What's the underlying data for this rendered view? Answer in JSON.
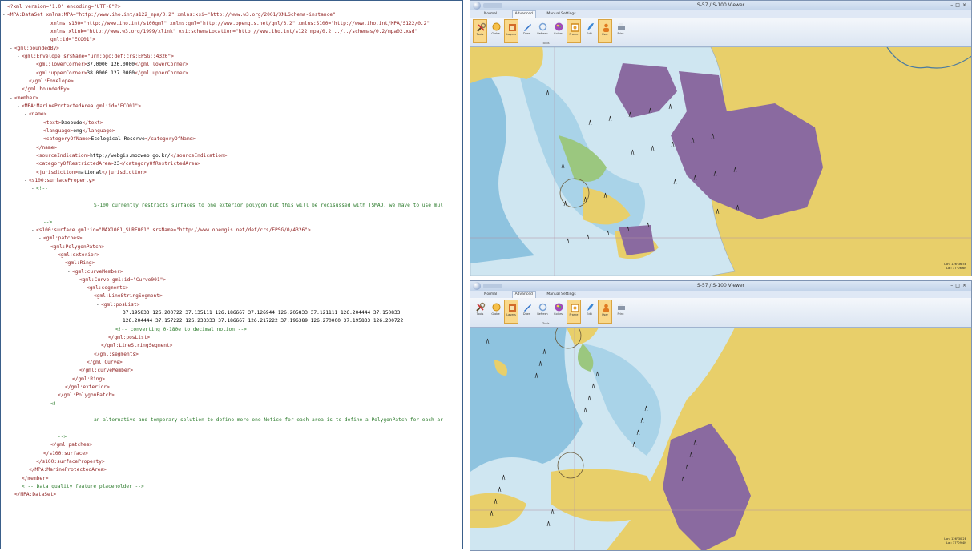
{
  "xml": {
    "lines": [
      {
        "indent": 0,
        "tw": "",
        "parts": [
          [
            "tag",
            "<?xml version=\"1.0\" encoding=\"UTF-8\"?>"
          ]
        ]
      },
      {
        "indent": 0,
        "tw": "-",
        "parts": [
          [
            "tag",
            "<MPA:DataSet xmlns:MPA=\"http://www.iho.int/s122_mpa/0.2\" xmlns:xsi=\"http://www.w3.org/2001/XMLSchema-instance\""
          ]
        ]
      },
      {
        "indent": 6,
        "tw": "",
        "parts": [
          [
            "tag",
            "xmlns:s100=\"http://www.iho.int/s100gml\" xmlns:gml=\"http://www.opengis.net/gml/3.2\" xmlns:S100=\"http://www.iho.int/MPA/S122/0.2\""
          ]
        ]
      },
      {
        "indent": 6,
        "tw": "",
        "parts": [
          [
            "tag",
            "xmlns:xlink=\"http://www.w3.org/1999/xlink\" xsi:schemaLocation=\"http://www.iho.int/s122_mpa/0.2 ../../schemas/0.2/mpa02.xsd\""
          ]
        ]
      },
      {
        "indent": 6,
        "tw": "",
        "parts": [
          [
            "tag",
            "gml:id=\"ECO01\">"
          ]
        ]
      },
      {
        "indent": 1,
        "tw": "-",
        "parts": [
          [
            "tag",
            "<gml:boundedBy>"
          ]
        ]
      },
      {
        "indent": 2,
        "tw": "-",
        "parts": [
          [
            "tag",
            "<gml:Envelope srsName=\"urn:ogc:def:crs:EPSG::4326\">"
          ]
        ]
      },
      {
        "indent": 4,
        "tw": "",
        "parts": [
          [
            "tag",
            "<gml:lowerCorner>"
          ],
          [
            "txt",
            "37.0000 126.0000"
          ],
          [
            "tag",
            "</gml:lowerCorner>"
          ]
        ]
      },
      {
        "indent": 4,
        "tw": "",
        "parts": [
          [
            "tag",
            "<gml:upperCorner>"
          ],
          [
            "txt",
            "38.0000 127.0000"
          ],
          [
            "tag",
            "</gml:upperCorner>"
          ]
        ]
      },
      {
        "indent": 3,
        "tw": "",
        "parts": [
          [
            "tag",
            "</gml:Envelope>"
          ]
        ]
      },
      {
        "indent": 2,
        "tw": "",
        "parts": [
          [
            "tag",
            "</gml:boundedBy>"
          ]
        ]
      },
      {
        "indent": 1,
        "tw": "-",
        "parts": [
          [
            "tag",
            "<member>"
          ]
        ]
      },
      {
        "indent": 2,
        "tw": "-",
        "parts": [
          [
            "tag",
            "<MPA:MarineProtectedArea gml:id=\"ECO01\">"
          ]
        ]
      },
      {
        "indent": 3,
        "tw": "-",
        "parts": [
          [
            "tag",
            "<name>"
          ]
        ]
      },
      {
        "indent": 5,
        "tw": "",
        "parts": [
          [
            "tag",
            "<text>"
          ],
          [
            "txt",
            "Daebudo"
          ],
          [
            "tag",
            "</text>"
          ]
        ]
      },
      {
        "indent": 5,
        "tw": "",
        "parts": [
          [
            "tag",
            "<language>"
          ],
          [
            "txt",
            "eng"
          ],
          [
            "tag",
            "</language>"
          ]
        ]
      },
      {
        "indent": 5,
        "tw": "",
        "parts": [
          [
            "tag",
            "<categoryOfName>"
          ],
          [
            "txt",
            "Ecological Reserve"
          ],
          [
            "tag",
            "</categoryOfName>"
          ]
        ]
      },
      {
        "indent": 4,
        "tw": "",
        "parts": [
          [
            "tag",
            "</name>"
          ]
        ]
      },
      {
        "indent": 4,
        "tw": "",
        "parts": [
          [
            "tag",
            "<sourceIndication>"
          ],
          [
            "txt",
            "http://webgis.mozweb.go.kr/"
          ],
          [
            "tag",
            "</sourceIndication>"
          ]
        ]
      },
      {
        "indent": 4,
        "tw": "",
        "parts": [
          [
            "tag",
            "<categoryOfRestrictedArea>"
          ],
          [
            "txt",
            "23"
          ],
          [
            "tag",
            "</categoryOfRestrictedArea>"
          ]
        ]
      },
      {
        "indent": 4,
        "tw": "",
        "parts": [
          [
            "tag",
            "<jurisdiction>"
          ],
          [
            "txt",
            "national"
          ],
          [
            "tag",
            "</jurisdiction>"
          ]
        ]
      },
      {
        "indent": 3,
        "tw": "-",
        "parts": [
          [
            "tag",
            "<s100:surfaceProperty>"
          ]
        ]
      },
      {
        "indent": 4,
        "tw": "-",
        "parts": [
          [
            "cmt",
            "<!--"
          ]
        ]
      },
      {
        "indent": 0,
        "tw": "",
        "parts": []
      },
      {
        "indent": 12,
        "tw": "",
        "parts": [
          [
            "cmt",
            "S-100 currently restricts surfaces to one exterior polygon but this will be redisussed with TSMAD. we have to use mul"
          ]
        ]
      },
      {
        "indent": 0,
        "tw": "",
        "parts": []
      },
      {
        "indent": 5,
        "tw": "",
        "parts": [
          [
            "cmt",
            "-->"
          ]
        ]
      },
      {
        "indent": 4,
        "tw": "-",
        "parts": [
          [
            "tag",
            "<s100:surface gml:id=\"MAX1001_SURF001\" srsName=\"http://www.opengis.net/def/crs/EPSG/0/4326\">"
          ]
        ]
      },
      {
        "indent": 5,
        "tw": "-",
        "parts": [
          [
            "tag",
            "<gml:patches>"
          ]
        ]
      },
      {
        "indent": 6,
        "tw": "-",
        "parts": [
          [
            "tag",
            "<gml:PolygonPatch>"
          ]
        ]
      },
      {
        "indent": 7,
        "tw": "-",
        "parts": [
          [
            "tag",
            "<gml:exterior>"
          ]
        ]
      },
      {
        "indent": 8,
        "tw": "-",
        "parts": [
          [
            "tag",
            "<gml:Ring>"
          ]
        ]
      },
      {
        "indent": 9,
        "tw": "-",
        "parts": [
          [
            "tag",
            "<gml:curveMember>"
          ]
        ]
      },
      {
        "indent": 10,
        "tw": "-",
        "parts": [
          [
            "tag",
            "<gml:Curve gml:id=\"Curve001\">"
          ]
        ]
      },
      {
        "indent": 11,
        "tw": "-",
        "parts": [
          [
            "tag",
            "<gml:segments>"
          ]
        ]
      },
      {
        "indent": 12,
        "tw": "-",
        "parts": [
          [
            "tag",
            "<gml:LineStringSegment>"
          ]
        ]
      },
      {
        "indent": 13,
        "tw": "-",
        "parts": [
          [
            "tag",
            "<gml:posList>"
          ]
        ]
      },
      {
        "indent": 16,
        "tw": "",
        "parts": [
          [
            "txt",
            "37.195833 126.200722 37.135111 126.186667 37.126944 126.205833 37.121111 126.204444 37.150833"
          ]
        ]
      },
      {
        "indent": 16,
        "tw": "",
        "parts": [
          [
            "txt",
            "126.204444 37.157222 126.233333 37.186667 126.217222 37.196389 126.270000 37.195833 126.200722"
          ]
        ]
      },
      {
        "indent": 15,
        "tw": "",
        "parts": [
          [
            "cmt",
            "<!-- converting 0-180e to decimal notion -->"
          ]
        ]
      },
      {
        "indent": 14,
        "tw": "",
        "parts": [
          [
            "tag",
            "</gml:posList>"
          ]
        ]
      },
      {
        "indent": 13,
        "tw": "",
        "parts": [
          [
            "tag",
            "</gml:LineStringSegment>"
          ]
        ]
      },
      {
        "indent": 12,
        "tw": "",
        "parts": [
          [
            "tag",
            "</gml:segments>"
          ]
        ]
      },
      {
        "indent": 11,
        "tw": "",
        "parts": [
          [
            "tag",
            "</gml:Curve>"
          ]
        ]
      },
      {
        "indent": 10,
        "tw": "",
        "parts": [
          [
            "tag",
            "</gml:curveMember>"
          ]
        ]
      },
      {
        "indent": 9,
        "tw": "",
        "parts": [
          [
            "tag",
            "</gml:Ring>"
          ]
        ]
      },
      {
        "indent": 8,
        "tw": "",
        "parts": [
          [
            "tag",
            "</gml:exterior>"
          ]
        ]
      },
      {
        "indent": 7,
        "tw": "",
        "parts": [
          [
            "tag",
            "</gml:PolygonPatch>"
          ]
        ]
      },
      {
        "indent": 6,
        "tw": "-",
        "parts": [
          [
            "cmt",
            "<!--"
          ]
        ]
      },
      {
        "indent": 0,
        "tw": "",
        "parts": []
      },
      {
        "indent": 12,
        "tw": "",
        "parts": [
          [
            "cmt",
            "an alternative and temporary solution to define more one Notice for each area is to define a PolygonPatch for each ar"
          ]
        ]
      },
      {
        "indent": 0,
        "tw": "",
        "parts": []
      },
      {
        "indent": 7,
        "tw": "",
        "parts": [
          [
            "cmt",
            "-->"
          ]
        ]
      },
      {
        "indent": 6,
        "tw": "",
        "parts": [
          [
            "tag",
            "</gml:patches>"
          ]
        ]
      },
      {
        "indent": 5,
        "tw": "",
        "parts": [
          [
            "tag",
            "</s100:surface>"
          ]
        ]
      },
      {
        "indent": 4,
        "tw": "",
        "parts": [
          [
            "tag",
            "</s100:surfaceProperty>"
          ]
        ]
      },
      {
        "indent": 3,
        "tw": "",
        "parts": [
          [
            "tag",
            "</MPA:MarineProtectedArea>"
          ]
        ]
      },
      {
        "indent": 2,
        "tw": "",
        "parts": [
          [
            "tag",
            "</member>"
          ]
        ]
      },
      {
        "indent": 2,
        "tw": "",
        "parts": [
          [
            "cmt",
            "<!-- Data quality feature placeholder -->"
          ]
        ]
      },
      {
        "indent": 1,
        "tw": "",
        "parts": [
          [
            "tag",
            "</MPA:DataSet>"
          ]
        ]
      }
    ]
  },
  "windows": [
    {
      "title": "S-57 / S-100 Viewer",
      "tabs": [
        "Normal",
        "Advanced",
        "Manual Settings"
      ],
      "active_tab": 1,
      "buttons": [
        {
          "icon": "tools",
          "label": "Tools",
          "selected": true
        },
        {
          "icon": "circle",
          "label": "Globe",
          "selected": false
        },
        {
          "icon": "layers",
          "label": "Layers",
          "selected": true
        },
        {
          "icon": "pen",
          "label": "Draw",
          "selected": false
        },
        {
          "icon": "refresh",
          "label": "Refresh",
          "selected": false
        },
        {
          "icon": "palette",
          "label": "Colors",
          "selected": false
        },
        {
          "icon": "frame",
          "label": "Frame",
          "selected": true
        },
        {
          "icon": "feather",
          "label": "Edit",
          "selected": false
        },
        {
          "icon": "person",
          "label": "User",
          "selected": true
        },
        {
          "icon": "print",
          "label": "Print",
          "selected": false
        }
      ],
      "group_label": "Tools",
      "coords": [
        "Lon: 126°36.5E",
        "Lat: 37°06.6N"
      ],
      "variant": 1
    },
    {
      "title": "S-57 / S-100 Viewer",
      "tabs": [
        "Normal",
        "Advanced",
        "Manual Settings"
      ],
      "active_tab": 1,
      "buttons": [
        {
          "icon": "tools",
          "label": "Tools",
          "selected": false
        },
        {
          "icon": "circle",
          "label": "Globe",
          "selected": false
        },
        {
          "icon": "layers",
          "label": "Layers",
          "selected": true
        },
        {
          "icon": "pen",
          "label": "Draw",
          "selected": false
        },
        {
          "icon": "refresh",
          "label": "Refresh",
          "selected": false
        },
        {
          "icon": "palette",
          "label": "Colors",
          "selected": false
        },
        {
          "icon": "frame",
          "label": "Frame",
          "selected": true
        },
        {
          "icon": "feather",
          "label": "Edit",
          "selected": false
        },
        {
          "icon": "person",
          "label": "User",
          "selected": true
        },
        {
          "icon": "print",
          "label": "Print",
          "selected": false
        }
      ],
      "group_label": "Tools",
      "coords": [
        "Lon: 126°30.2E",
        "Lat: 37°09.4N"
      ],
      "variant": 2
    }
  ],
  "colors": {
    "land": "#e8cf6a",
    "shallow": "#a9d3e8",
    "sea": "#cfe6f1",
    "deep": "#8ec3df",
    "mpa": "#8a6aa0",
    "green": "#9bc77f",
    "xml_tag": "#8b1a1a",
    "xml_comment": "#2a7a2a"
  }
}
